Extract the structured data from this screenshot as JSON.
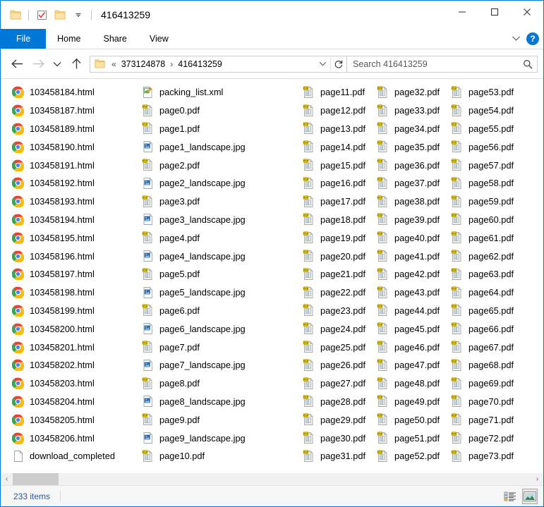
{
  "window": {
    "title": "416413259",
    "quick_access": [
      {
        "name": "folder-icon",
        "label": "Folder"
      },
      {
        "name": "properties-icon",
        "label": "Properties"
      },
      {
        "name": "new-folder-icon",
        "label": "New folder"
      },
      {
        "name": "customize-qat-icon",
        "label": "Customize Quick Access Toolbar"
      }
    ],
    "controls": {
      "minimize": "Minimize",
      "maximize": "Maximize",
      "close": "Close"
    }
  },
  "ribbon": {
    "tabs": [
      {
        "label": "File",
        "active": true
      },
      {
        "label": "Home",
        "active": false
      },
      {
        "label": "Share",
        "active": false
      },
      {
        "label": "View",
        "active": false
      }
    ],
    "expand_label": "Expand the Ribbon",
    "help_label": "?"
  },
  "nav": {
    "back": "Back",
    "forward": "Forward",
    "recent": "Recent locations",
    "up": "Up",
    "breadcrumbs": [
      "373124878",
      "416413259"
    ],
    "breadcrumb_prefix": "«",
    "breadcrumb_sep": "›",
    "refresh": "Refresh"
  },
  "search": {
    "placeholder": "Search 416413259",
    "value": "",
    "icon": "search-icon"
  },
  "files": {
    "columns": [
      [
        {
          "name": "103458184.html",
          "icon": "chrome"
        },
        {
          "name": "103458187.html",
          "icon": "chrome"
        },
        {
          "name": "103458189.html",
          "icon": "chrome"
        },
        {
          "name": "103458190.html",
          "icon": "chrome"
        },
        {
          "name": "103458191.html",
          "icon": "chrome"
        },
        {
          "name": "103458192.html",
          "icon": "chrome"
        },
        {
          "name": "103458193.html",
          "icon": "chrome"
        },
        {
          "name": "103458194.html",
          "icon": "chrome"
        },
        {
          "name": "103458195.html",
          "icon": "chrome"
        },
        {
          "name": "103458196.html",
          "icon": "chrome"
        },
        {
          "name": "103458197.html",
          "icon": "chrome"
        },
        {
          "name": "103458198.html",
          "icon": "chrome"
        },
        {
          "name": "103458199.html",
          "icon": "chrome"
        },
        {
          "name": "103458200.html",
          "icon": "chrome"
        },
        {
          "name": "103458201.html",
          "icon": "chrome"
        },
        {
          "name": "103458202.html",
          "icon": "chrome"
        },
        {
          "name": "103458203.html",
          "icon": "chrome"
        },
        {
          "name": "103458204.html",
          "icon": "chrome"
        },
        {
          "name": "103458205.html",
          "icon": "chrome"
        },
        {
          "name": "103458206.html",
          "icon": "chrome"
        },
        {
          "name": "download_completed",
          "icon": "blank"
        }
      ],
      [
        {
          "name": "packing_list.xml",
          "icon": "xml"
        },
        {
          "name": "page0.pdf",
          "icon": "pdf"
        },
        {
          "name": "page1.pdf",
          "icon": "pdf"
        },
        {
          "name": "page1_landscape.jpg",
          "icon": "jpg"
        },
        {
          "name": "page2.pdf",
          "icon": "pdf"
        },
        {
          "name": "page2_landscape.jpg",
          "icon": "jpg"
        },
        {
          "name": "page3.pdf",
          "icon": "pdf"
        },
        {
          "name": "page3_landscape.jpg",
          "icon": "jpg"
        },
        {
          "name": "page4.pdf",
          "icon": "pdf"
        },
        {
          "name": "page4_landscape.jpg",
          "icon": "jpg"
        },
        {
          "name": "page5.pdf",
          "icon": "pdf"
        },
        {
          "name": "page5_landscape.jpg",
          "icon": "jpg"
        },
        {
          "name": "page6.pdf",
          "icon": "pdf"
        },
        {
          "name": "page6_landscape.jpg",
          "icon": "jpg"
        },
        {
          "name": "page7.pdf",
          "icon": "pdf"
        },
        {
          "name": "page7_landscape.jpg",
          "icon": "jpg"
        },
        {
          "name": "page8.pdf",
          "icon": "pdf"
        },
        {
          "name": "page8_landscape.jpg",
          "icon": "jpg"
        },
        {
          "name": "page9.pdf",
          "icon": "pdf"
        },
        {
          "name": "page9_landscape.jpg",
          "icon": "jpg"
        },
        {
          "name": "page10.pdf",
          "icon": "pdf"
        }
      ],
      [
        {
          "name": "page11.pdf",
          "icon": "pdf"
        },
        {
          "name": "page12.pdf",
          "icon": "pdf"
        },
        {
          "name": "page13.pdf",
          "icon": "pdf"
        },
        {
          "name": "page14.pdf",
          "icon": "pdf"
        },
        {
          "name": "page15.pdf",
          "icon": "pdf"
        },
        {
          "name": "page16.pdf",
          "icon": "pdf"
        },
        {
          "name": "page17.pdf",
          "icon": "pdf"
        },
        {
          "name": "page18.pdf",
          "icon": "pdf"
        },
        {
          "name": "page19.pdf",
          "icon": "pdf"
        },
        {
          "name": "page20.pdf",
          "icon": "pdf"
        },
        {
          "name": "page21.pdf",
          "icon": "pdf"
        },
        {
          "name": "page22.pdf",
          "icon": "pdf"
        },
        {
          "name": "page23.pdf",
          "icon": "pdf"
        },
        {
          "name": "page24.pdf",
          "icon": "pdf"
        },
        {
          "name": "page25.pdf",
          "icon": "pdf"
        },
        {
          "name": "page26.pdf",
          "icon": "pdf"
        },
        {
          "name": "page27.pdf",
          "icon": "pdf"
        },
        {
          "name": "page28.pdf",
          "icon": "pdf"
        },
        {
          "name": "page29.pdf",
          "icon": "pdf"
        },
        {
          "name": "page30.pdf",
          "icon": "pdf"
        },
        {
          "name": "page31.pdf",
          "icon": "pdf"
        }
      ],
      [
        {
          "name": "page32.pdf",
          "icon": "pdf"
        },
        {
          "name": "page33.pdf",
          "icon": "pdf"
        },
        {
          "name": "page34.pdf",
          "icon": "pdf"
        },
        {
          "name": "page35.pdf",
          "icon": "pdf"
        },
        {
          "name": "page36.pdf",
          "icon": "pdf"
        },
        {
          "name": "page37.pdf",
          "icon": "pdf"
        },
        {
          "name": "page38.pdf",
          "icon": "pdf"
        },
        {
          "name": "page39.pdf",
          "icon": "pdf"
        },
        {
          "name": "page40.pdf",
          "icon": "pdf"
        },
        {
          "name": "page41.pdf",
          "icon": "pdf"
        },
        {
          "name": "page42.pdf",
          "icon": "pdf"
        },
        {
          "name": "page43.pdf",
          "icon": "pdf"
        },
        {
          "name": "page44.pdf",
          "icon": "pdf"
        },
        {
          "name": "page45.pdf",
          "icon": "pdf"
        },
        {
          "name": "page46.pdf",
          "icon": "pdf"
        },
        {
          "name": "page47.pdf",
          "icon": "pdf"
        },
        {
          "name": "page48.pdf",
          "icon": "pdf"
        },
        {
          "name": "page49.pdf",
          "icon": "pdf"
        },
        {
          "name": "page50.pdf",
          "icon": "pdf"
        },
        {
          "name": "page51.pdf",
          "icon": "pdf"
        },
        {
          "name": "page52.pdf",
          "icon": "pdf"
        }
      ],
      [
        {
          "name": "page53.pdf",
          "icon": "pdf"
        },
        {
          "name": "page54.pdf",
          "icon": "pdf"
        },
        {
          "name": "page55.pdf",
          "icon": "pdf"
        },
        {
          "name": "page56.pdf",
          "icon": "pdf"
        },
        {
          "name": "page57.pdf",
          "icon": "pdf"
        },
        {
          "name": "page58.pdf",
          "icon": "pdf"
        },
        {
          "name": "page59.pdf",
          "icon": "pdf"
        },
        {
          "name": "page60.pdf",
          "icon": "pdf"
        },
        {
          "name": "page61.pdf",
          "icon": "pdf"
        },
        {
          "name": "page62.pdf",
          "icon": "pdf"
        },
        {
          "name": "page63.pdf",
          "icon": "pdf"
        },
        {
          "name": "page64.pdf",
          "icon": "pdf"
        },
        {
          "name": "page65.pdf",
          "icon": "pdf"
        },
        {
          "name": "page66.pdf",
          "icon": "pdf"
        },
        {
          "name": "page67.pdf",
          "icon": "pdf"
        },
        {
          "name": "page68.pdf",
          "icon": "pdf"
        },
        {
          "name": "page69.pdf",
          "icon": "pdf"
        },
        {
          "name": "page70.pdf",
          "icon": "pdf"
        },
        {
          "name": "page71.pdf",
          "icon": "pdf"
        },
        {
          "name": "page72.pdf",
          "icon": "pdf"
        },
        {
          "name": "page73.pdf",
          "icon": "pdf"
        }
      ]
    ]
  },
  "scrollbar": {
    "left_arrow": "‹",
    "right_arrow": "›"
  },
  "status": {
    "item_count": "233 items",
    "view_details": "Details view",
    "view_large_icons": "Large icons view",
    "active_view": "large-icons"
  },
  "colors": {
    "accent": "#0078d7",
    "status_text": "#2b5797",
    "folder_yellow": "#fcd884",
    "pdf_badge": "#f5d400"
  }
}
